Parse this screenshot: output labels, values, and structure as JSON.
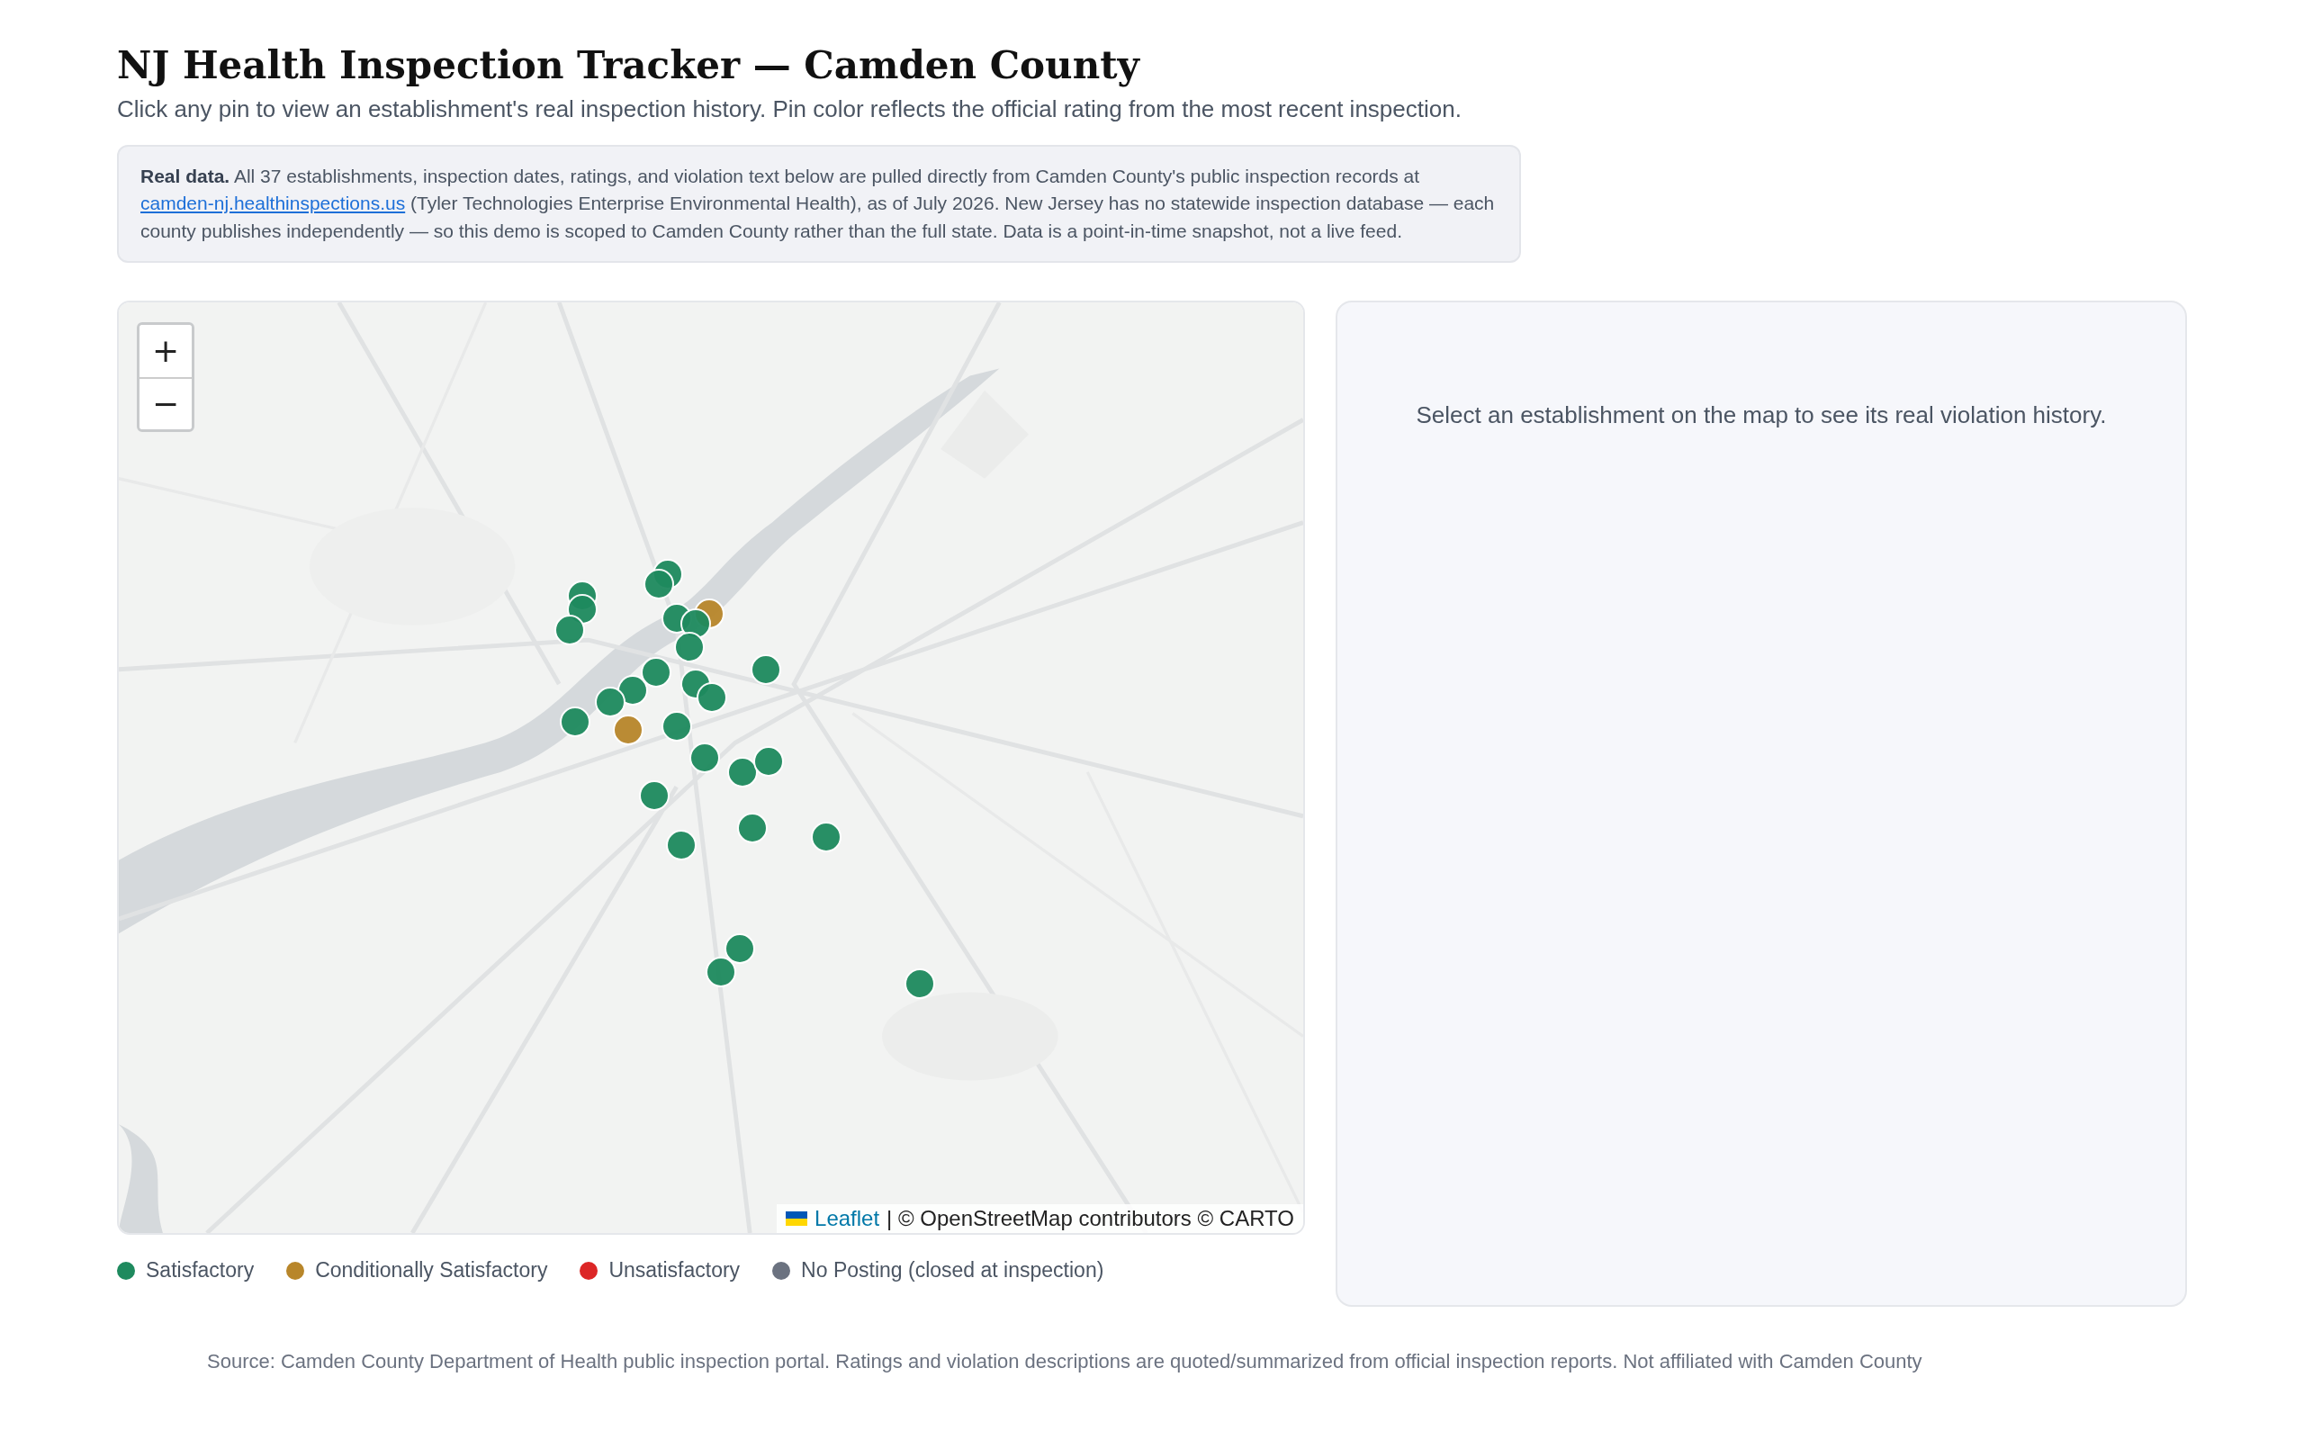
{
  "title": "NJ Health Inspection Tracker — Camden County",
  "subtitle": "Click any pin to view an establishment's real inspection history. Pin color reflects the official rating from the most recent inspection.",
  "notice": {
    "lead": "Real data.",
    "before_link": "All 37 establishments, inspection dates, ratings, and violation text below are pulled directly from Camden County's public inspection records at",
    "link": "camden-nj.healthinspections.us",
    "after_link": "(Tyler Technologies Enterprise Environmental Health), as of July 2026. New Jersey has no statewide inspection database — each county publishes independently — so this demo is scoped to Camden County rather than the full state. Data is a point-in-time snapshot, not a live feed."
  },
  "map": {
    "zoom_in": "+",
    "zoom_out": "−",
    "attribution_link": "Leaflet",
    "attribution_text": "| © OpenStreetMap contributors © CARTO",
    "pins": [
      {
        "color": "#1e8a5e"
      },
      {
        "color": "#1e8a5e"
      },
      {
        "color": "#1e8a5e"
      },
      {
        "color": "#1e8a5e"
      },
      {
        "color": "#1e8a5e"
      },
      {
        "color": "#1e8a5e"
      },
      {
        "color": "#b8862a"
      },
      {
        "color": "#1e8a5e"
      },
      {
        "color": "#1e8a5e"
      },
      {
        "color": "#1e8a5e"
      },
      {
        "color": "#1e8a5e"
      },
      {
        "color": "#1e8a5e"
      },
      {
        "color": "#1e8a5e"
      },
      {
        "color": "#1e8a5e"
      },
      {
        "color": "#1e8a5e"
      },
      {
        "color": "#1e8a5e"
      },
      {
        "color": "#b8862a"
      },
      {
        "color": "#1e8a5e"
      },
      {
        "color": "#1e8a5e"
      },
      {
        "color": "#1e8a5e"
      },
      {
        "color": "#1e8a5e"
      },
      {
        "color": "#1e8a5e"
      },
      {
        "color": "#1e8a5e"
      },
      {
        "color": "#1e8a5e"
      },
      {
        "color": "#1e8a5e"
      },
      {
        "color": "#1e8a5e"
      },
      {
        "color": "#1e8a5e"
      },
      {
        "color": "#1e8a5e"
      }
    ]
  },
  "legend": [
    {
      "label": "Satisfactory",
      "color": "#1e8a5e"
    },
    {
      "label": "Conditionally Satisfactory",
      "color": "#b8862a"
    },
    {
      "label": "Unsatisfactory",
      "color": "#dc2626"
    },
    {
      "label": "No Posting (closed at inspection)",
      "color": "#6b7280"
    }
  ],
  "detail_placeholder": "Select an establishment on the map to see its real violation history.",
  "footer": "Source: Camden County Department of Health public inspection portal. Ratings and violation descriptions are quoted/summarized from official inspection reports. Not affiliated with Camden County"
}
